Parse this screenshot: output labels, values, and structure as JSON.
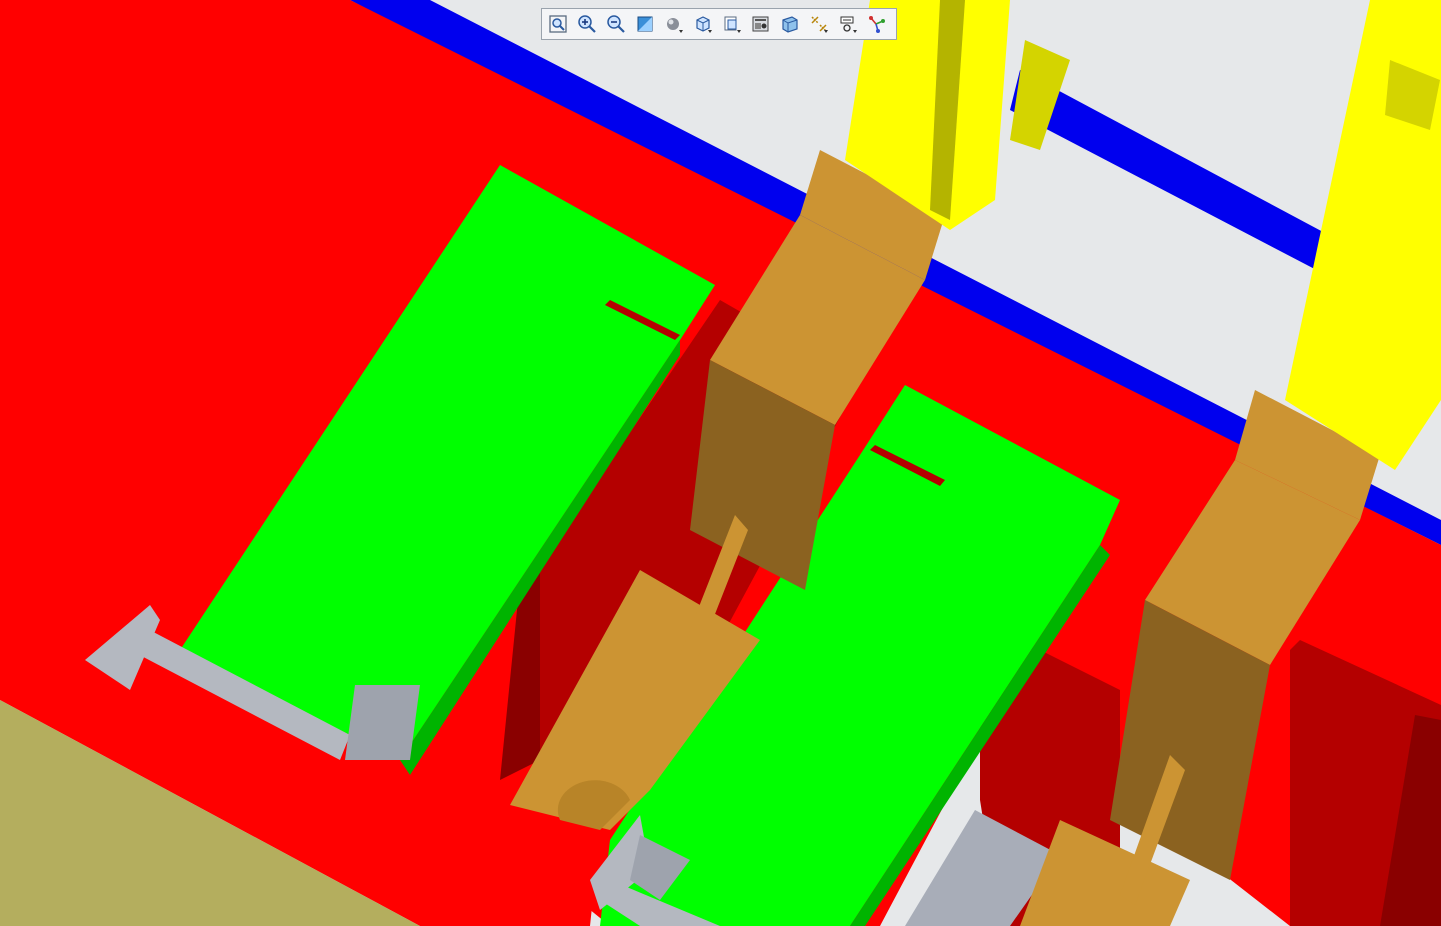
{
  "viewport": {
    "background": "#e6e8ea",
    "colors": {
      "base_red": "#ff0000",
      "base_red_dark": "#b40000",
      "base_red_deep": "#8a0000",
      "plate_green": "#00ff00",
      "plate_green_dark": "#00b400",
      "rail_blue": "#0000ee",
      "bracket_tan": "#cc9433",
      "bracket_tan_dark": "#8b6220",
      "cylinder_yellow": "#ffff00",
      "cylinder_yellow_dark": "#b4b400",
      "side_olive": "#b4ae5e",
      "actuator_grey": "#b4b8c0"
    }
  },
  "toolbar": {
    "tools": [
      {
        "name": "refit-icon"
      },
      {
        "name": "zoom-in-icon"
      },
      {
        "name": "zoom-out-icon"
      },
      {
        "name": "repaint-icon"
      },
      {
        "name": "display-style-icon"
      },
      {
        "name": "standard-orientation-icon"
      },
      {
        "name": "saved-views-icon"
      },
      {
        "name": "view-manager-icon"
      },
      {
        "name": "perspective-icon"
      },
      {
        "name": "datum-display-icon"
      },
      {
        "name": "annotation-display-icon"
      },
      {
        "name": "spin-center-icon"
      }
    ]
  }
}
